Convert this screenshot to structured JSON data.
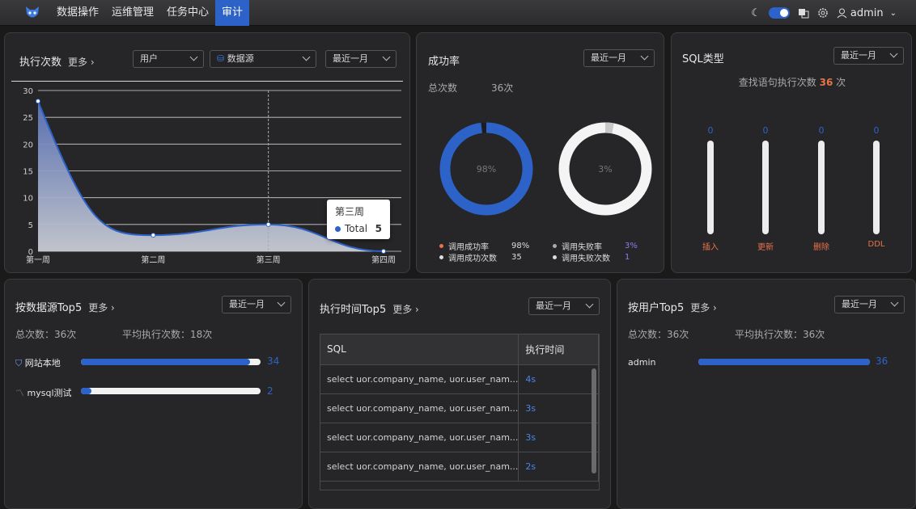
{
  "nav": {
    "items": [
      "数据操作",
      "运维管理",
      "任务中心",
      "审计"
    ],
    "active": 3
  },
  "topbar": {
    "user": "admin"
  },
  "exec_count": {
    "title": "执行次数",
    "more": "更多",
    "filter_user": "用户",
    "filter_source": "数据源",
    "filter_period": "最近一月",
    "tooltip_title": "第三周",
    "tooltip_series": "Total",
    "tooltip_value": "5"
  },
  "chart_data": {
    "type": "area",
    "categories": [
      "第一周",
      "第二周",
      "第三周",
      "第四周"
    ],
    "series": [
      {
        "name": "Total",
        "values": [
          28,
          3,
          5,
          0
        ]
      }
    ],
    "ylim": [
      0,
      30
    ],
    "yticks": [
      0,
      5,
      10,
      15,
      20,
      25,
      30
    ],
    "color": "#2d63c8"
  },
  "success": {
    "title": "成功率",
    "period": "最近一月",
    "total_label": "总次数",
    "total_value": "36次",
    "ring1_label": "98%",
    "ring1_fraction": 0.98,
    "ring2_label": "3%",
    "ring2_fraction": 0.03,
    "legend": {
      "success_rate_label": "调用成功率",
      "success_rate": "98%",
      "success_count_label": "调用成功次数",
      "success_count": "35",
      "fail_rate_label": "调用失败率",
      "fail_rate": "3%",
      "fail_count_label": "调用失败次数",
      "fail_count": "1"
    }
  },
  "sql_type": {
    "title": "SQL类型",
    "period": "最近一月",
    "summary_prefix": "查找语句执行次数",
    "summary_value": "36",
    "summary_suffix": "次",
    "bars": [
      {
        "label": "插入",
        "value": "0"
      },
      {
        "label": "更新",
        "value": "0"
      },
      {
        "label": "删除",
        "value": "0"
      },
      {
        "label": "DDL",
        "value": "0"
      }
    ]
  },
  "by_source": {
    "title": "按数据源Top5",
    "more": "更多",
    "period": "最近一月",
    "total": "总次数：36次",
    "avg": "平均执行次数：18次",
    "items": [
      {
        "name": "网站本地",
        "value": "34",
        "fraction": 0.94
      },
      {
        "name": "mysql测试",
        "value": "2",
        "fraction": 0.06
      }
    ]
  },
  "exec_time": {
    "title": "执行时间Top5",
    "more": "更多",
    "period": "最近一月",
    "col_sql": "SQL",
    "col_time": "执行时间",
    "rows": [
      {
        "sql": "select uor.company_name, uor.user_nam...",
        "time": "4s"
      },
      {
        "sql": "select uor.company_name, uor.user_nam...",
        "time": "3s"
      },
      {
        "sql": "select uor.company_name, uor.user_nam...",
        "time": "3s"
      },
      {
        "sql": "select uor.company_name, uor.user_nam...",
        "time": "2s"
      }
    ]
  },
  "by_user": {
    "title": "按用户Top5",
    "more": "更多",
    "period": "最近一月",
    "total": "总次数：36次",
    "avg": "平均执行次数：36次",
    "items": [
      {
        "name": "admin",
        "value": "36",
        "fraction": 1.0
      }
    ]
  }
}
